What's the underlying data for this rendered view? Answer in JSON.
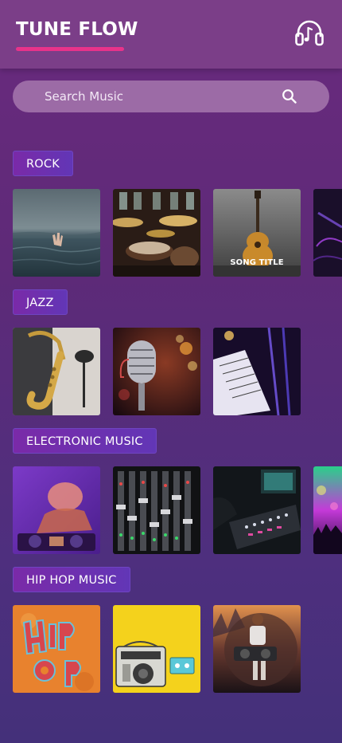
{
  "app": {
    "title": "TUNE FLOW",
    "headphone_icon": "headphones-icon"
  },
  "colors": {
    "accent": "#e8338a",
    "header": "#7b3e88",
    "search_bg": "#9c6ba6",
    "label_bg": "#6a30b0"
  },
  "search": {
    "placeholder": "Search Music",
    "icon": "search-icon"
  },
  "sections": [
    {
      "label": "ROCK",
      "tiles": [
        {
          "name": "tile-rock-ocean-hand",
          "caption": ""
        },
        {
          "name": "tile-rock-drum-kit",
          "caption": ""
        },
        {
          "name": "tile-rock-acoustic-guitar",
          "caption": "SONG TITLE"
        },
        {
          "name": "tile-rock-purple-guitar",
          "caption": ""
        }
      ]
    },
    {
      "label": "JAZZ",
      "tiles": [
        {
          "name": "tile-jazz-saxophone",
          "caption": ""
        },
        {
          "name": "tile-jazz-microphone",
          "caption": ""
        },
        {
          "name": "tile-jazz-sheet-music",
          "caption": ""
        }
      ]
    },
    {
      "label": "ELECTRONIC MUSIC",
      "tiles": [
        {
          "name": "tile-electronic-dj",
          "caption": ""
        },
        {
          "name": "tile-electronic-mixer",
          "caption": ""
        },
        {
          "name": "tile-electronic-synth",
          "caption": ""
        },
        {
          "name": "tile-electronic-concert",
          "caption": ""
        }
      ]
    },
    {
      "label": "HIP HOP MUSIC",
      "tiles": [
        {
          "name": "tile-hiphop-graffiti",
          "caption": ""
        },
        {
          "name": "tile-hiphop-boombox",
          "caption": ""
        },
        {
          "name": "tile-hiphop-artist",
          "caption": ""
        }
      ]
    }
  ]
}
